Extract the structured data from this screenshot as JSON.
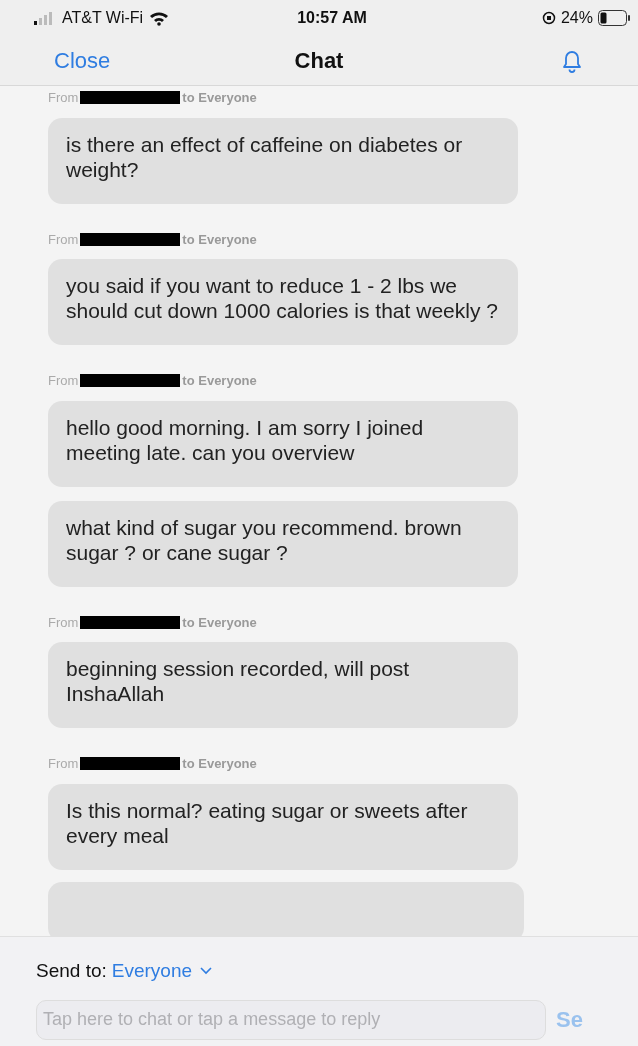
{
  "status_bar": {
    "carrier": "AT&T Wi-Fi",
    "time": "10:57 AM",
    "battery": "24%"
  },
  "nav": {
    "close": "Close",
    "title": "Chat"
  },
  "groups": [
    {
      "from": "From",
      "to": "to Everyone",
      "redacted": true,
      "messages": [
        "is there an effect of caffeine on diabetes or weight?"
      ]
    },
    {
      "from": "From",
      "to": "to Everyone",
      "redacted": true,
      "messages": [
        "you said if you want to reduce 1 - 2 lbs we should cut down 1000 calories is that weekly ?"
      ]
    },
    {
      "from": "From",
      "to": "to Everyone",
      "redacted": true,
      "messages": [
        "hello good morning. I am sorry I joined meeting late. can you overview",
        "what kind of sugar you recommend.  brown sugar ? or cane sugar ?"
      ]
    },
    {
      "from": "From",
      "to": "to Everyone",
      "redacted": true,
      "messages": [
        "beginning session recorded,  will post InshaAllah"
      ]
    },
    {
      "from": "From",
      "to": "to Everyone",
      "redacted": true,
      "messages": [
        "Is this normal? eating sugar or sweets after every meal"
      ]
    }
  ],
  "footer": {
    "send_to_label": "Send to:",
    "recipient": "Everyone",
    "placeholder": "Tap here to chat or tap a message to reply",
    "send": "Se"
  }
}
